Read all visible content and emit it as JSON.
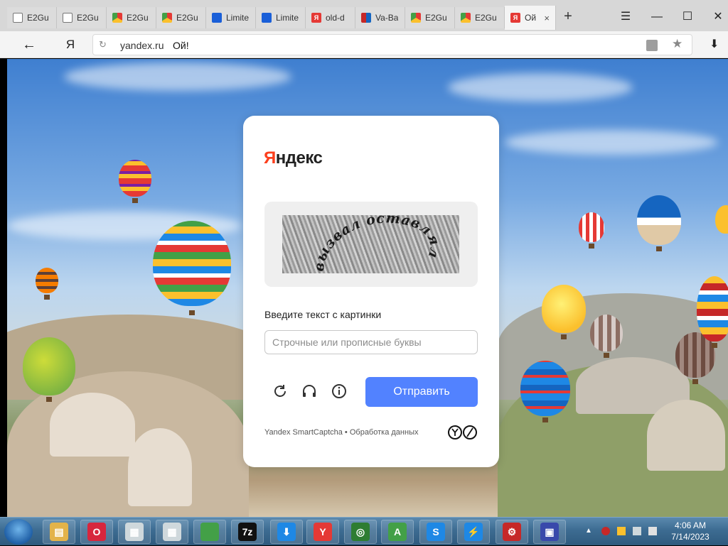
{
  "browser": {
    "tabs": [
      {
        "label": "E2Gu",
        "favicon": "doc-icon",
        "active": false
      },
      {
        "label": "E2Gu",
        "favicon": "doc-icon",
        "active": false
      },
      {
        "label": "E2Gu",
        "favicon": "chrome-icon",
        "active": false
      },
      {
        "label": "E2Gu",
        "favicon": "chrome-icon",
        "active": false
      },
      {
        "label": "Limite",
        "favicon": "blue-square-icon",
        "active": false
      },
      {
        "label": "Limite",
        "favicon": "blue-square-icon",
        "active": false
      },
      {
        "label": "old-d",
        "favicon": "yandex-icon",
        "active": false
      },
      {
        "label": "Va-Ba",
        "favicon": "ms-icon",
        "active": false
      },
      {
        "label": "E2Gu",
        "favicon": "chrome-icon",
        "active": false
      },
      {
        "label": "E2Gu",
        "favicon": "chrome-icon",
        "active": false
      },
      {
        "label": "Ой",
        "favicon": "yandex-icon",
        "active": true
      }
    ],
    "new_tab_glyph": "+",
    "menu_glyph": "☰",
    "minimize_glyph": "—",
    "maximize_glyph": "☐",
    "close_glyph": "✕",
    "tab_close_glyph": "×",
    "back_glyph": "←",
    "yandex_button": "Я",
    "address": {
      "domain": "yandex.ru",
      "page_title": "Ой!"
    },
    "reload_glyph": "↻",
    "star_glyph": "★",
    "download_glyph": "⬇"
  },
  "captcha": {
    "brand_first_letter": "Я",
    "brand_rest": "ндекс",
    "image_text": "вызвал оставлял",
    "prompt": "Введите текст с картинки",
    "input_placeholder": "Строчные или прописные буквы",
    "input_value": "",
    "refresh_icon": "refresh-icon",
    "audio_icon": "headphones-icon",
    "info_icon": "info-icon",
    "submit_label": "Отправить",
    "footer_service": "Yandex SmartCaptcha",
    "footer_separator": "•",
    "footer_link": "Обработка данных",
    "accent_color": "#5282ff",
    "brand_color": "#fc3f1d"
  },
  "taskbar": {
    "items": [
      {
        "name": "file-explorer",
        "glyph": "▤",
        "color": "#e3b34a"
      },
      {
        "name": "opera",
        "glyph": "O",
        "color": "#d7263d"
      },
      {
        "name": "window-1",
        "glyph": "▦",
        "color": "#cfd8dc"
      },
      {
        "name": "window-2",
        "glyph": "▦",
        "color": "#cfd8dc"
      },
      {
        "name": "chrome",
        "glyph": "",
        "color": "#43a047"
      },
      {
        "name": "7zip",
        "glyph": "7z",
        "color": "#111111"
      },
      {
        "name": "installer",
        "glyph": "⬇",
        "color": "#1e88e5"
      },
      {
        "name": "yandex-browser",
        "glyph": "Y",
        "color": "#e53935"
      },
      {
        "name": "search-app",
        "glyph": "◎",
        "color": "#2e7d32"
      },
      {
        "name": "a-app",
        "glyph": "A",
        "color": "#43a047"
      },
      {
        "name": "skype",
        "glyph": "S",
        "color": "#1e88e5"
      },
      {
        "name": "lightning-app",
        "glyph": "⚡",
        "color": "#1e88e5"
      },
      {
        "name": "settings-app",
        "glyph": "⚙",
        "color": "#c62828"
      },
      {
        "name": "network-app",
        "glyph": "▣",
        "color": "#3949ab"
      }
    ],
    "tray": {
      "show_hidden_glyph": "▲",
      "time": "4:06 AM",
      "date": "7/14/2023"
    }
  }
}
